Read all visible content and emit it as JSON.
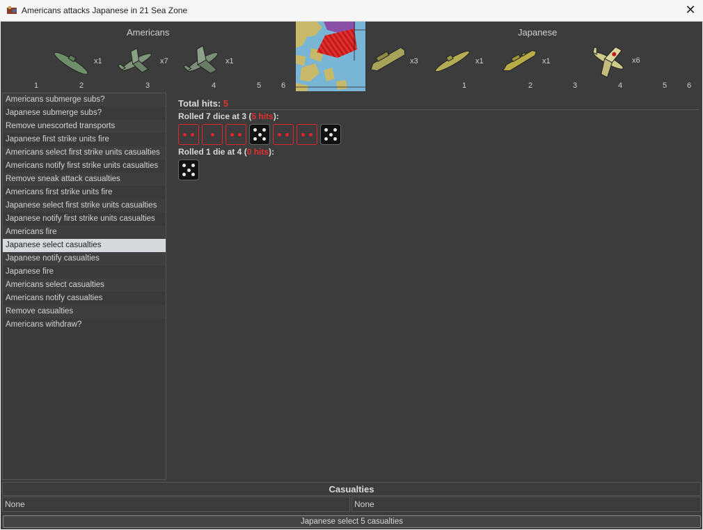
{
  "window": {
    "title": "Americans attacks Japanese in 21 Sea Zone",
    "close_glyph": "✕"
  },
  "attacker": {
    "name": "Americans",
    "units": [
      {
        "icon": "submarine-icon",
        "count": "x1"
      },
      {
        "icon": "fighter-icon",
        "count": "x7"
      },
      {
        "icon": "bomber-icon",
        "count": "x1"
      }
    ],
    "die_labels": [
      "1",
      "2",
      "3",
      "4",
      "5",
      "6"
    ]
  },
  "defender": {
    "name": "Japanese",
    "units": [
      {
        "icon": "transport-icon",
        "count": "x3"
      },
      {
        "icon": "submarine-icon",
        "count": "x1"
      },
      {
        "icon": "destroyer-icon",
        "count": "x1"
      },
      {
        "icon": "fighter-icon",
        "count": "x6"
      }
    ],
    "die_labels": [
      "1",
      "2",
      "3",
      "4",
      "5",
      "6"
    ]
  },
  "steps": [
    "Americans submerge subs?",
    "Japanese submerge subs?",
    "Remove unescorted transports",
    "Japanese first strike units fire",
    "Americans select first strike units casualties",
    "Americans notify first strike units casualties",
    "Remove sneak attack casualties",
    "Americans first strike units fire",
    "Japanese select first strike units casualties",
    "Japanese notify first strike units casualties",
    "Americans fire",
    "Japanese select casualties",
    "Japanese notify casualties",
    "Japanese fire",
    "Americans select casualties",
    "Americans notify casualties",
    "Remove casualties",
    "Americans withdraw?"
  ],
  "selected_step": 11,
  "results": {
    "total_label": "Total hits:",
    "total_value": "5",
    "rolls": [
      {
        "prefix": "Rolled 7 dice at 3 (",
        "hits": "5 hits",
        "suffix": "):",
        "dice": [
          {
            "value": 2,
            "hit": true
          },
          {
            "value": 1,
            "hit": true
          },
          {
            "value": 2,
            "hit": true
          },
          {
            "value": 5,
            "hit": false
          },
          {
            "value": 2,
            "hit": true
          },
          {
            "value": 2,
            "hit": true
          },
          {
            "value": 5,
            "hit": false
          }
        ]
      },
      {
        "prefix": "Rolled 1 die at 4 (",
        "hits": "0 hits",
        "suffix": "):",
        "dice": [
          {
            "value": 5,
            "hit": false
          }
        ]
      }
    ]
  },
  "casualties": {
    "title": "Casualties",
    "attacker": "None",
    "defender": "None"
  },
  "action_button": "Japanese select 5 casualties",
  "colors": {
    "hit_red": "#e0262b",
    "panel": "#3c3c3c",
    "selected_row": "#d7d9dd"
  }
}
